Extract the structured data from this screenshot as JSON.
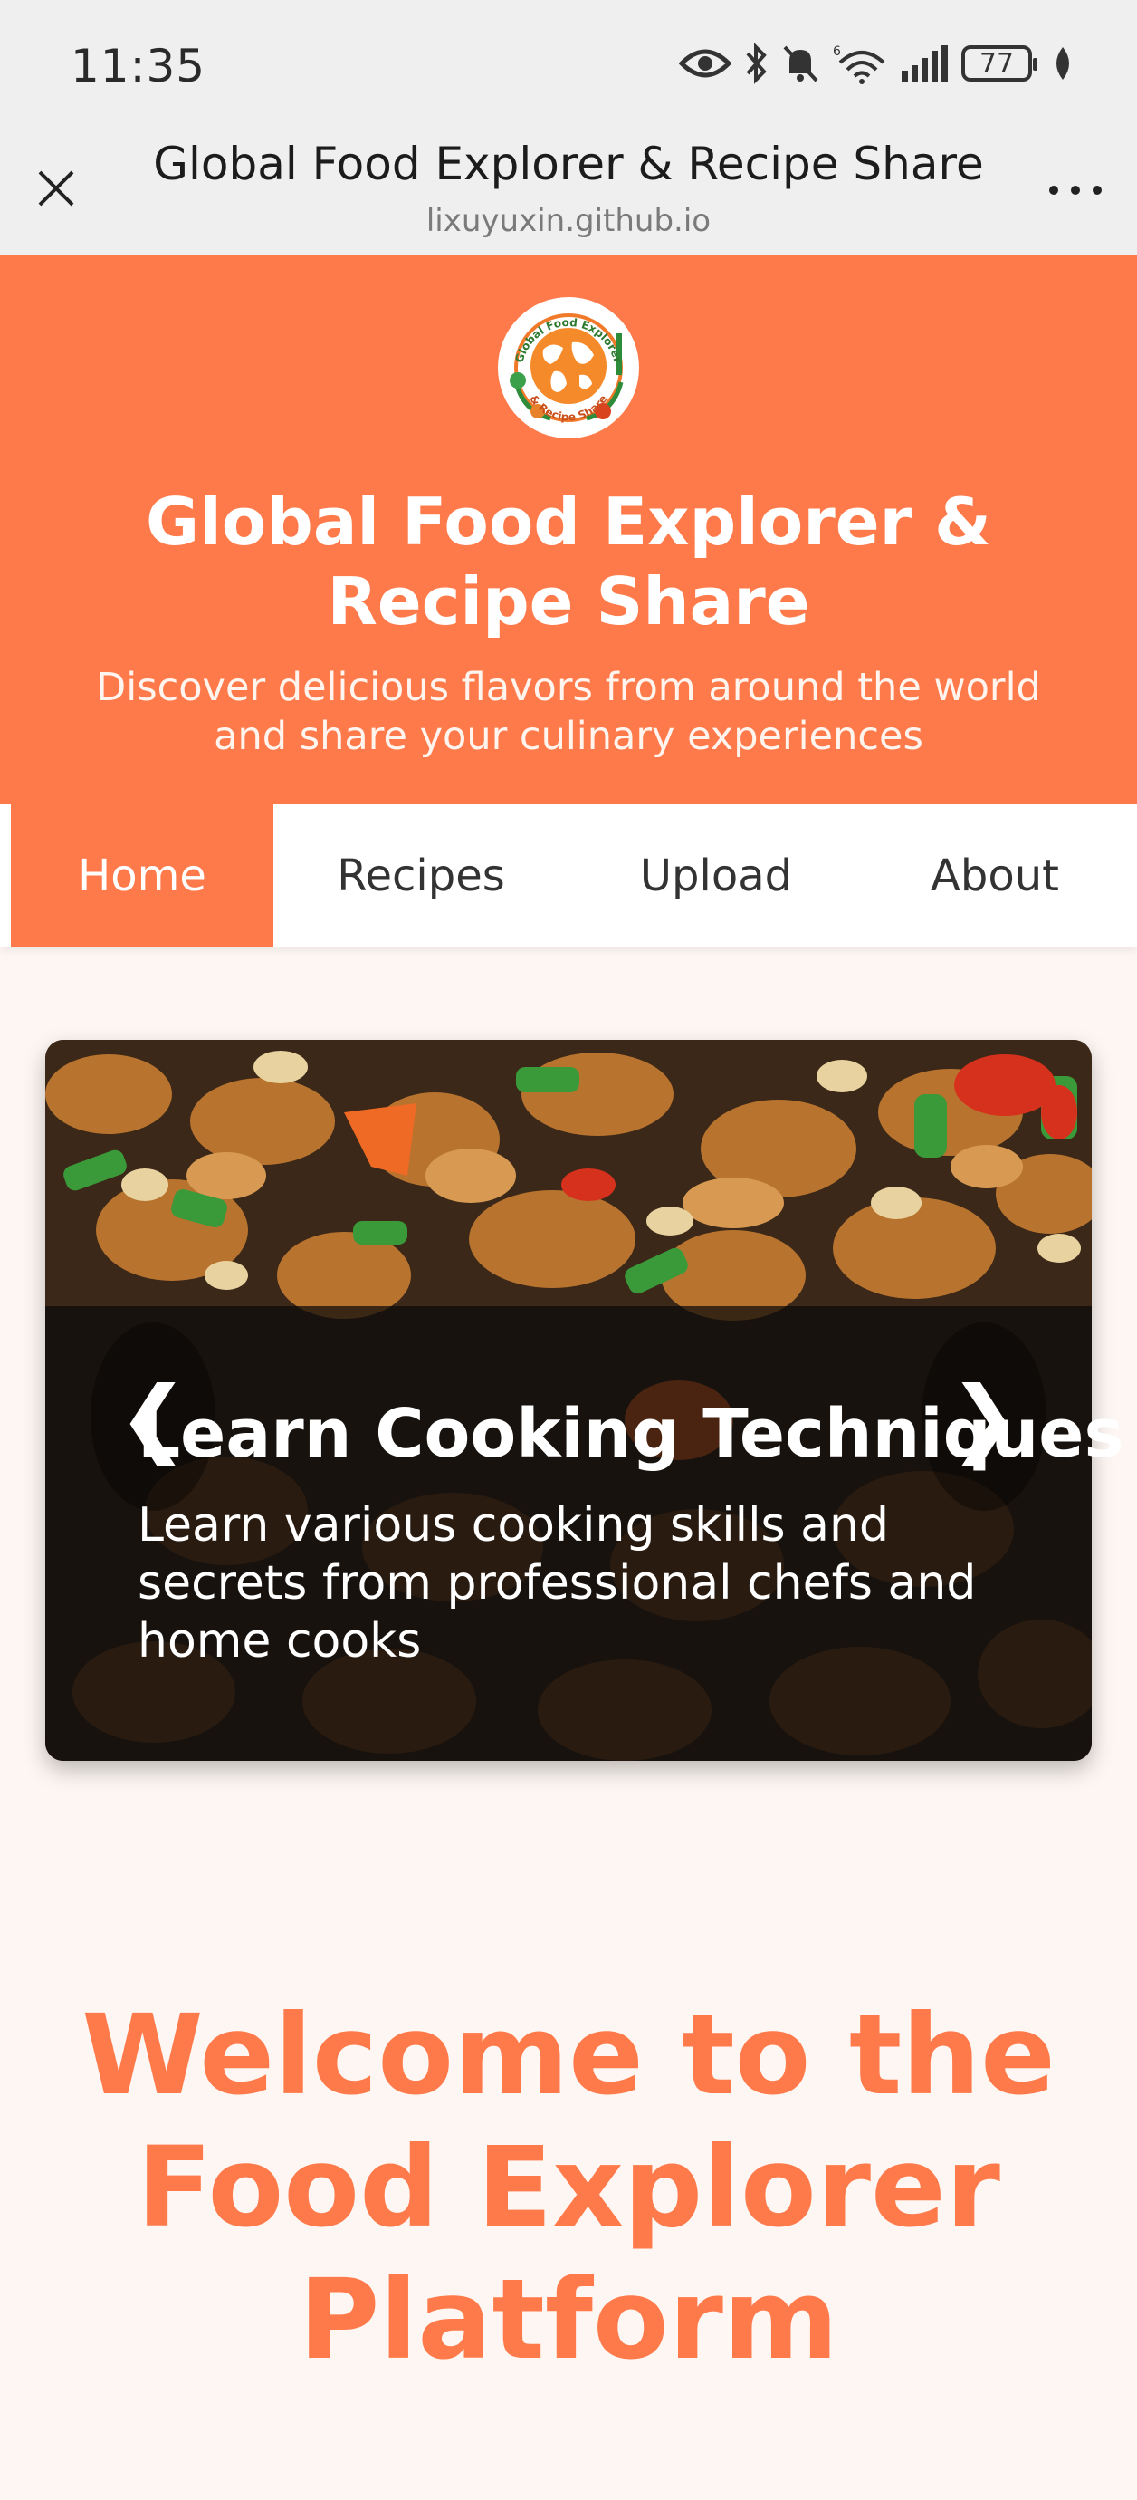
{
  "status_bar": {
    "time": "11:35",
    "battery": "77",
    "icons": [
      "eye-icon",
      "bluetooth-icon",
      "mute-icon",
      "wifi-icon",
      "signal-icon",
      "battery-icon",
      "leaf-icon"
    ]
  },
  "browser": {
    "title": "Global Food Explorer & Recipe Share",
    "url": "lixuyuxin.github.io"
  },
  "hero": {
    "logo_text_top": "Global Food Explorer",
    "logo_text_bottom": "& Recipe Share",
    "title": "Global Food Explorer & Recipe Share",
    "subtitle": "Discover delicious flavors from around the world and share your culinary experiences"
  },
  "nav": {
    "items": [
      {
        "label": "Home",
        "active": true
      },
      {
        "label": "Recipes",
        "active": false
      },
      {
        "label": "Upload",
        "active": false
      },
      {
        "label": "About",
        "active": false
      }
    ]
  },
  "carousel": {
    "slide_title": "Learn Cooking Techniques",
    "slide_text": "Learn various cooking skills and secrets from professional chefs and home cooks",
    "prev_symbol": "❮",
    "next_symbol": "❯"
  },
  "welcome": {
    "heading": "Welcome to the Food Explorer Platform"
  },
  "colors": {
    "brand": "#ff7a4a",
    "page_background": "#fdf6f2",
    "browser_chrome": "#efefef"
  }
}
